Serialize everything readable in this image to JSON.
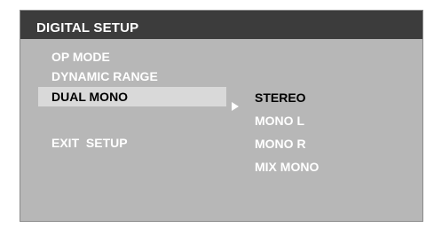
{
  "header": {
    "title": "DIGITAL SETUP"
  },
  "menu": {
    "items": [
      {
        "label": "OP MODE"
      },
      {
        "label": "DYNAMIC RANGE"
      },
      {
        "label": "DUAL MONO"
      },
      {
        "label": "EXIT  SETUP"
      }
    ],
    "selected_label": "DUAL MONO"
  },
  "submenu": {
    "items": [
      {
        "label": "STEREO"
      },
      {
        "label": "MONO L"
      },
      {
        "label": "MONO R"
      },
      {
        "label": "MIX MONO"
      }
    ],
    "highlighted_label": "STEREO"
  },
  "colors": {
    "background": "#b7b7b7",
    "header_bar": "#3c3c3c",
    "selection_bar": "#d9d9d9",
    "text": "#ffffff",
    "selected_text": "#000000"
  },
  "icons": {
    "submenu_pointer": "triangle-right-icon"
  }
}
